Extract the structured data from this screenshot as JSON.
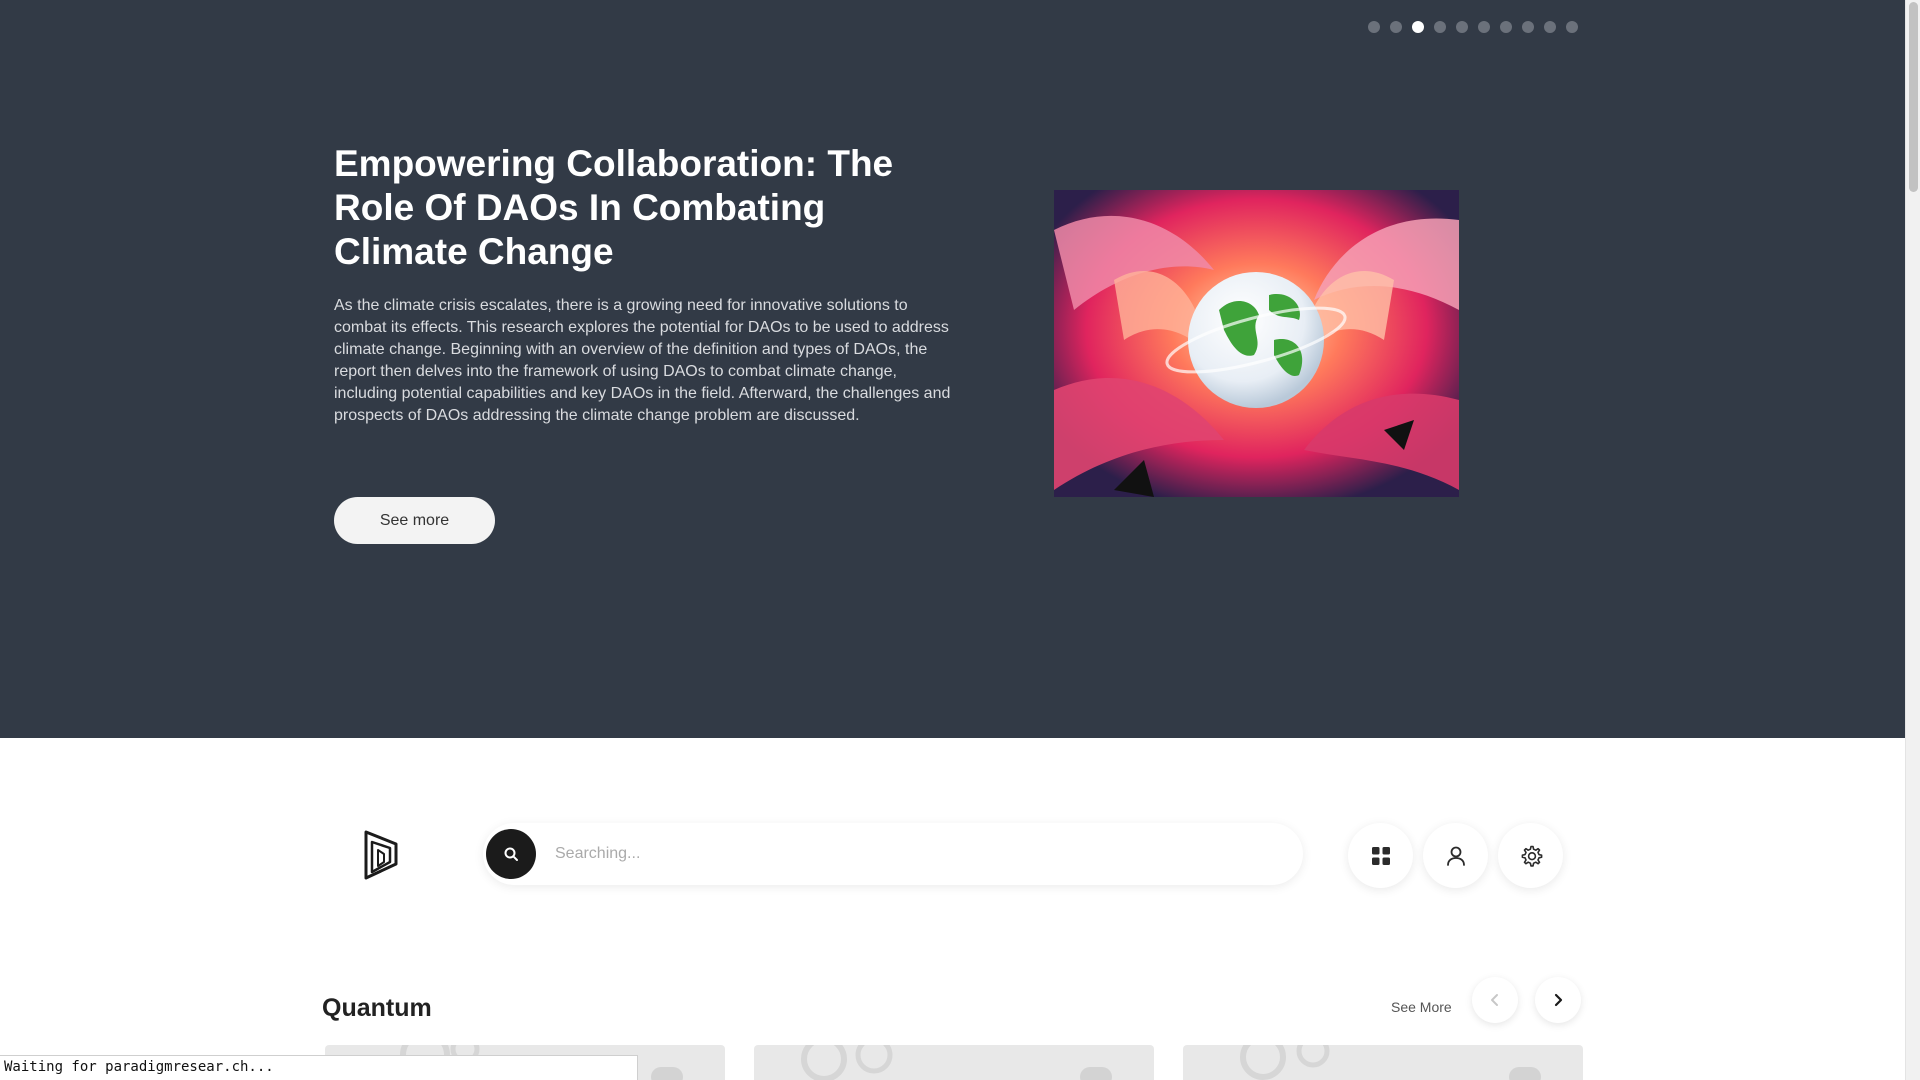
{
  "hero": {
    "slide_count": 10,
    "active_slide": 3,
    "title": "Empowering Collaboration: The Role Of DAOs In Combating Climate Change",
    "description": "As the climate crisis escalates, there is a growing need for innovative solutions to combat its effects. This research explores the potential for DAOs to be used to address climate change. Beginning with an overview of the definition and types of DAOs, the report then delves into the framework of using DAOs to combat climate change, including potential capabilities and key DAOs in the field. Afterward, the challenges and prospects of DAOs addressing the climate change problem are discussed.",
    "button_label": "See more",
    "image_icon": "hands-around-globe-illustration"
  },
  "toolbar": {
    "logo_icon": "paradigm-logo-icon",
    "search_placeholder": "Searching...",
    "search_icon": "search-icon",
    "buttons": [
      {
        "icon": "grid-icon"
      },
      {
        "icon": "user-icon"
      },
      {
        "icon": "gear-icon"
      }
    ]
  },
  "section": {
    "title": "Quantum",
    "see_more_label": "See More",
    "prev_icon": "chevron-left-icon",
    "next_icon": "chevron-right-icon",
    "card_count": 3
  },
  "status_bar": {
    "text": "Waiting for paradigmresear.ch..."
  },
  "colors": {
    "hero_bg": "#323a46",
    "accent_dark": "#1b1b1b",
    "page_bg": "#ffffff"
  }
}
